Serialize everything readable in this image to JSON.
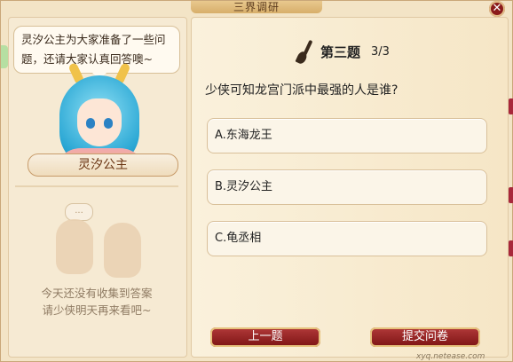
{
  "window": {
    "title": "三界调研",
    "close_label": "✕"
  },
  "left_panel": {
    "speech": "灵汐公主为大家准备了一些问题，还请大家认真回答噢~",
    "character_name": "灵汐公主",
    "empty_speech": "...",
    "empty_message_line1": "今天还没有收集到答案",
    "empty_message_line2": "请少侠明天再来看吧~"
  },
  "quiz": {
    "question_label": "第三题",
    "progress": "3/3",
    "question": "少侠可知龙宫门派中最强的人是谁?",
    "options": [
      {
        "label": "A.东海龙王"
      },
      {
        "label": "B.灵汐公主"
      },
      {
        "label": "C.龟丞相"
      }
    ]
  },
  "buttons": {
    "prev": "上一题",
    "submit": "提交问卷"
  },
  "watermark": {
    "url": "xyq.netease.com"
  },
  "colors": {
    "button_red": "#8b1b1b",
    "accent_gold": "#e6c27d"
  }
}
